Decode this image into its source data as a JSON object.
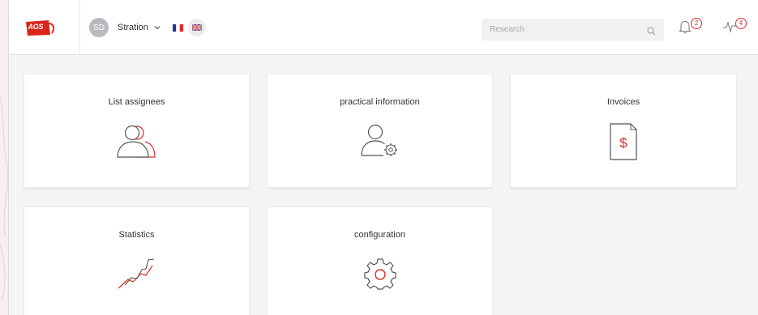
{
  "header": {
    "logo_text": "AGS",
    "user": {
      "initials": "SD",
      "name": "Stration"
    },
    "search": {
      "placeholder": "Research"
    },
    "notifications": {
      "bell_count": "2",
      "activity_count": "4"
    }
  },
  "cards": [
    {
      "title": "List assignees",
      "icon": "users-icon"
    },
    {
      "title": "practical information",
      "icon": "user-settings-icon"
    },
    {
      "title": "Invoices",
      "icon": "invoice-dollar-icon"
    },
    {
      "title": "Statistics",
      "icon": "statistics-chart-icon"
    },
    {
      "title": "configuration",
      "icon": "gear-icon"
    }
  ],
  "colors": {
    "accent": "#e12a2a",
    "icon_stroke": "#555555"
  }
}
